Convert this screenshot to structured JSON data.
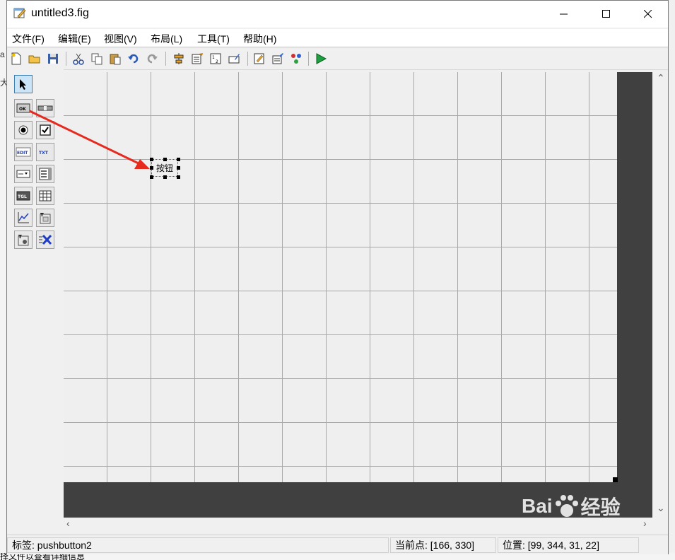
{
  "window": {
    "title": "untitled3.fig"
  },
  "menu": [
    "文件(F)",
    "编辑(E)",
    "视图(V)",
    "布局(L)",
    "工具(T)",
    "帮助(H)"
  ],
  "canvas": {
    "pushbutton_label": "按钮"
  },
  "status": {
    "tag_label": "标签: pushbutton2",
    "current_point": "当前点:  [166, 330]",
    "position": "位置: [99, 344, 31, 22]"
  },
  "background": {
    "left_fragment_1": "a",
    "left_fragment_2": "大",
    "bottom_fragment": "择文件以查看详细信息"
  },
  "watermark": {
    "text_1": "Bai",
    "text_2": "经验"
  }
}
